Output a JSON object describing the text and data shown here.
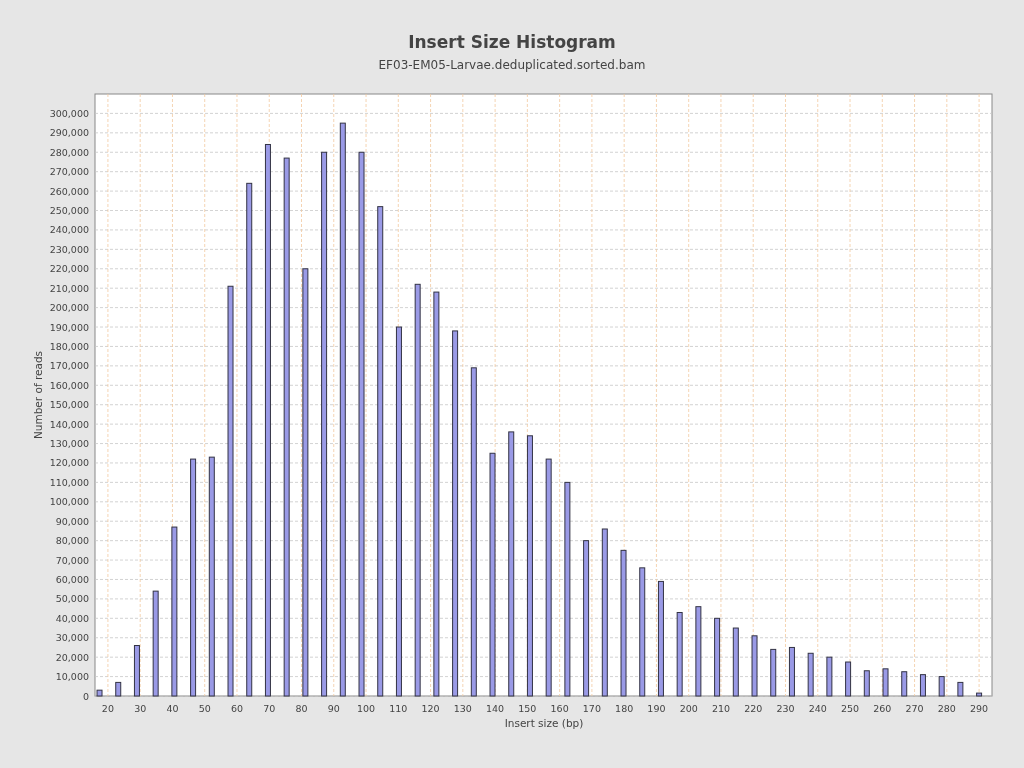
{
  "chart": {
    "subtitle": "EF03-EM05-Larvae.deduplicated.sorted.bam",
    "chart_data": {
      "type": "bar",
      "title": "Insert Size Histogram",
      "xlabel": "Insert size (bp)",
      "ylabel": "Number of reads",
      "grid": true,
      "x": [
        17.4,
        23.2,
        29.0,
        34.8,
        40.6,
        46.4,
        52.2,
        58.0,
        63.8,
        69.6,
        75.4,
        81.2,
        87.0,
        92.8,
        98.6,
        104.4,
        110.2,
        116.0,
        121.8,
        127.6,
        133.4,
        139.2,
        145.0,
        150.8,
        156.6,
        162.4,
        168.2,
        174.0,
        179.8,
        185.6,
        191.4,
        197.2,
        203.0,
        208.8,
        214.6,
        220.4,
        226.2,
        232.0,
        237.8,
        243.6,
        249.4,
        255.2,
        261.0,
        266.8,
        272.6,
        278.4,
        284.2,
        290.0
      ],
      "series": [
        {
          "color": "#9a9ae6",
          "values": [
            3000,
            7000,
            26000,
            54000,
            87000,
            122000,
            123000,
            211000,
            264000,
            284000,
            277000,
            220000,
            280000,
            295000,
            280000,
            252000,
            190000,
            212000,
            208000,
            188000,
            169000,
            125000,
            136000,
            134000,
            122000,
            110000,
            80000,
            86000,
            75000,
            66000,
            59000,
            43000,
            46000,
            40000,
            35000,
            31000,
            24000,
            25000,
            22000,
            20000,
            17500,
            13000,
            14000,
            12500,
            11000,
            10000,
            7000,
            1500
          ]
        }
      ],
      "xlim": [
        16,
        294
      ],
      "ylim": [
        0,
        310000
      ],
      "xticks": [
        20,
        30,
        40,
        50,
        60,
        70,
        80,
        90,
        100,
        110,
        120,
        130,
        140,
        150,
        160,
        170,
        180,
        190,
        200,
        210,
        220,
        230,
        240,
        250,
        260,
        270,
        280,
        290
      ],
      "yticks": [
        0,
        {
          "value": 10000,
          "label": "10,000"
        },
        {
          "value": 20000,
          "label": "20,000"
        },
        {
          "value": 30000,
          "label": "30,000"
        },
        {
          "value": 40000,
          "label": "40,000"
        },
        {
          "value": 50000,
          "label": "50,000"
        },
        {
          "value": 60000,
          "label": "60,000"
        },
        {
          "value": 70000,
          "label": "70,000"
        },
        {
          "value": 80000,
          "label": "80,000"
        },
        {
          "value": 90000,
          "label": "90,000"
        },
        {
          "value": 100000,
          "label": "100,000"
        },
        {
          "value": 110000,
          "label": "110,000"
        },
        {
          "value": 120000,
          "label": "120,000"
        },
        {
          "value": 130000,
          "label": "130,000"
        },
        {
          "value": 140000,
          "label": "140,000"
        },
        {
          "value": 150000,
          "label": "150,000"
        },
        {
          "value": 160000,
          "label": "160,000"
        },
        {
          "value": 170000,
          "label": "170,000"
        },
        {
          "value": 180000,
          "label": "180,000"
        },
        {
          "value": 190000,
          "label": "190,000"
        },
        {
          "value": 200000,
          "label": "200,000"
        },
        {
          "value": 210000,
          "label": "210,000"
        },
        {
          "value": 220000,
          "label": "220,000"
        },
        {
          "value": 230000,
          "label": "230,000"
        },
        {
          "value": 240000,
          "label": "240,000"
        },
        {
          "value": 250000,
          "label": "250,000"
        },
        {
          "value": 260000,
          "label": "260,000"
        },
        {
          "value": 270000,
          "label": "270,000"
        },
        {
          "value": 280000,
          "label": "280,000"
        },
        {
          "value": 290000,
          "label": "290,000"
        },
        {
          "value": 300000,
          "label": "300,000"
        }
      ]
    }
  }
}
